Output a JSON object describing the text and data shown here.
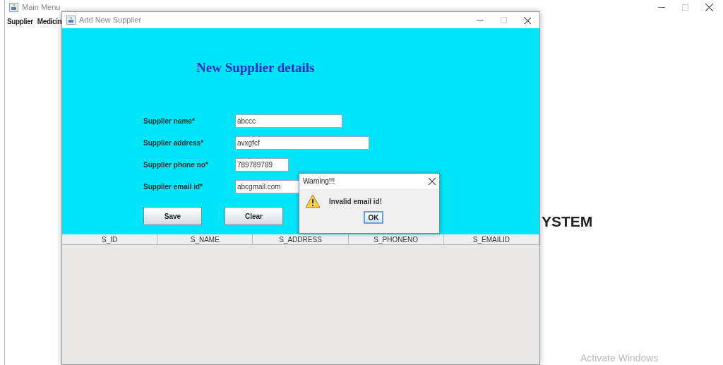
{
  "main_window": {
    "title": "Main Menu",
    "menu": [
      "Supplier",
      "Medicin"
    ],
    "heading_fragment": "YSTEM"
  },
  "supplier_window": {
    "title": "Add New Supplier",
    "heading": "New Supplier details",
    "fields": [
      {
        "label": "Supplier name*",
        "value": "abccc"
      },
      {
        "label": "Supplier address*",
        "value": "avxgfcf"
      },
      {
        "label": "Supplier phone no*",
        "value": "789789789"
      },
      {
        "label": "Supplier email id*",
        "value": "abcgmail.com"
      }
    ],
    "buttons": [
      "Save",
      "Clear"
    ],
    "table": {
      "columns": [
        "S_ID",
        "S_NAME",
        "S_ADDRESS",
        "S_PHONENO",
        "S_EMAILID"
      ]
    }
  },
  "dialog": {
    "title": "Warning!!!",
    "message": "Invalid email id!",
    "button": "OK"
  },
  "watermark_text": "Activate Windows"
}
